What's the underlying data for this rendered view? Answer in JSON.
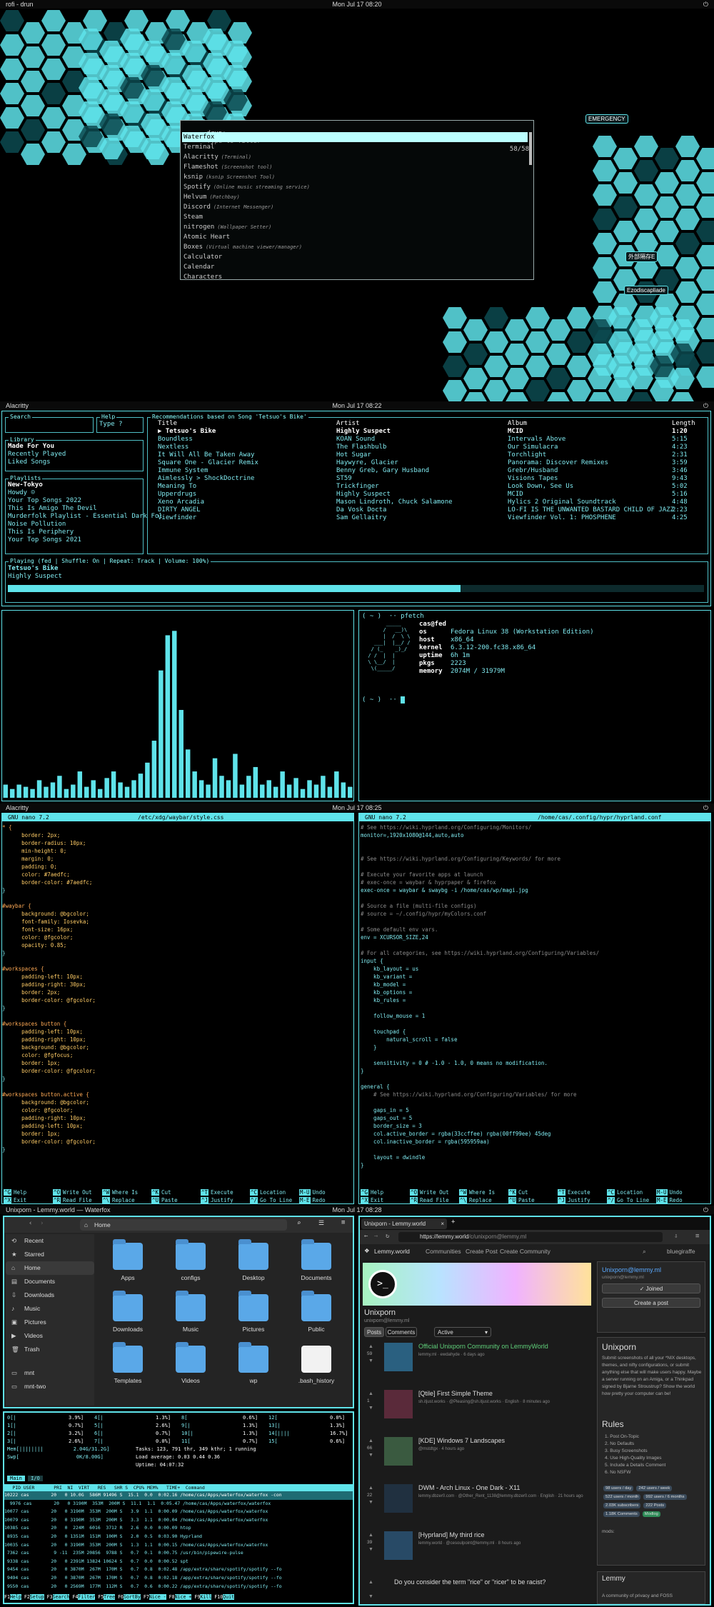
{
  "s1": {
    "left": "rofi - drun",
    "clock": "Mon Jul 17 08:20",
    "prompt": "drun:",
    "placeholder": "Type to filter",
    "count": "58/58",
    "items": [
      {
        "n": "Waterfox",
        "d": ""
      },
      {
        "n": "Terminal",
        "d": ""
      },
      {
        "n": "Alacritty",
        "d": "(Terminal)"
      },
      {
        "n": "Flameshot",
        "d": "(Screenshot tool)"
      },
      {
        "n": "ksnip",
        "d": "(ksnip Screenshot Tool)"
      },
      {
        "n": "Spotify",
        "d": "(Online music streaming service)"
      },
      {
        "n": "Helvum",
        "d": "(Patchbay)"
      },
      {
        "n": "Discord",
        "d": "(Internet Messenger)"
      },
      {
        "n": "Steam",
        "d": ""
      },
      {
        "n": "nitrogen",
        "d": "(Wallpaper Setter)"
      },
      {
        "n": "Atomic Heart",
        "d": ""
      },
      {
        "n": "Boxes",
        "d": "(Virtual machine viewer/manager)"
      },
      {
        "n": "Calculator",
        "d": ""
      },
      {
        "n": "Calendar",
        "d": ""
      },
      {
        "n": "Characters",
        "d": ""
      }
    ],
    "hexlabels": [
      "EMERGENCY",
      "外部隔存E",
      "Ezodiscapliade"
    ]
  },
  "s2": {
    "left": "Alacritty",
    "clock": "Mon Jul 17 08:22",
    "search": {
      "label": "Search"
    },
    "help": {
      "label": "Help",
      "value": "Type ?"
    },
    "library": {
      "label": "Library",
      "items": [
        "Made For You",
        "Recently Played",
        "Liked Songs"
      ]
    },
    "playlists": {
      "label": "Playlists",
      "items": [
        "New-Tokyo",
        "Howdy ☺",
        "Your Top Songs 2022",
        "This Is Amigo The Devil",
        "Murderfolk Playlist - Essential Dark Fol",
        "Noise Pollution",
        "This Is Periphery",
        "Your Top Songs 2021"
      ]
    },
    "recs": {
      "label": "Recommendations based on Song 'Tetsuo's Bike'",
      "headers": [
        "Title",
        "Artist",
        "Album",
        "Length"
      ],
      "rows": [
        [
          "▶ Tetsuo's Bike",
          "Highly Suspect",
          "MCID",
          "1:20"
        ],
        [
          "Boundless",
          "KOAN Sound",
          "Intervals Above",
          "5:15"
        ],
        [
          "Nextless",
          "The Flashbulb",
          "Our Simulacra",
          "4:23"
        ],
        [
          "It Will All Be Taken Away",
          "Hot Sugar",
          "Torchlight",
          "2:31"
        ],
        [
          "Square One - Glacier Remix",
          "Haywyre, Glacier",
          "Panorama: Discover Remixes",
          "3:59"
        ],
        [
          "Immune System",
          "Benny Greb, Gary Husband",
          "Grebr/Husband",
          "3:46"
        ],
        [
          "Aimlessly > ShockDoctrine",
          "ST59",
          "Visions Tapes",
          "9:43"
        ],
        [
          "Meaning To",
          "Trickfinger",
          "Look Down, See Us",
          "5:02"
        ],
        [
          "Upperdrugs",
          "Highly Suspect",
          "MCID",
          "5:16"
        ],
        [
          "Xeno Arcadia",
          "Mason Lindroth, Chuck Salamone",
          "Hylics 2 Original Soundtrack",
          "4:48"
        ],
        [
          "DIRTY ANGEL",
          "Da Vosk Docta",
          "LO-FI IS THE UNWANTED BASTARD CHILD OF JAZZ",
          "2:23"
        ],
        [
          "Viewfinder",
          "Sam Gellaitry",
          "Viewfinder Vol. 1: PHOSPHENE",
          "4:25"
        ]
      ]
    },
    "playing": {
      "status": "Playing (fed | Shuffle: On  | Repeat: Track | Volume: 100%)",
      "track": "Tetsuo's Bike",
      "artist": "Highly Suspect",
      "progress": 0.65
    },
    "viz": [
      6,
      4,
      6,
      5,
      4,
      8,
      5,
      7,
      10,
      4,
      6,
      12,
      5,
      8,
      4,
      9,
      12,
      7,
      5,
      8,
      11,
      16,
      26,
      58,
      74,
      76,
      40,
      22,
      12,
      8,
      6,
      18,
      10,
      8,
      20,
      6,
      10,
      14,
      6,
      8,
      5,
      12,
      6,
      9,
      4,
      8,
      6,
      10,
      5,
      12,
      7,
      5
    ],
    "pf": {
      "prompt": "( ~ )  ·· pfetch",
      "user": "cas@fed",
      "rows": [
        [
          "os",
          "Fedora Linux 38 (Workstation Edition)"
        ],
        [
          "host",
          "x86_64"
        ],
        [
          "kernel",
          "6.3.12-200.fc38.x86_64"
        ],
        [
          "uptime",
          "6h 1m"
        ],
        [
          "pkgs",
          "2223"
        ],
        [
          "memory",
          "2074M / 31979M"
        ]
      ],
      "prompt2": "( ~ )  ··"
    }
  },
  "s3": {
    "left": "Alacritty",
    "clock": "Mon Jul 17 08:25",
    "nano1": {
      "ver": "GNU nano 7.2",
      "file": "/etc/xdg/waybar/style.css"
    },
    "nano2": {
      "ver": "GNU nano 7.2",
      "file": "/home/cas/.config/hypr/hyprland.conf"
    },
    "keys": [
      [
        "^G",
        "Help"
      ],
      [
        "^O",
        "Write Out"
      ],
      [
        "^W",
        "Where Is"
      ],
      [
        "^K",
        "Cut"
      ],
      [
        "^T",
        "Execute"
      ],
      [
        "^C",
        "Location"
      ],
      [
        "M-U",
        "Undo"
      ],
      [
        "^X",
        "Exit"
      ],
      [
        "^R",
        "Read File"
      ],
      [
        "^\\",
        "Replace"
      ],
      [
        "^U",
        "Paste"
      ],
      [
        "^J",
        "Justify"
      ],
      [
        "^/",
        "Go To Line"
      ],
      [
        "M-E",
        "Redo"
      ]
    ],
    "css": [
      "* {",
      "      border: 2px;",
      "      border-radius: 10px;",
      "      min-height: 0;",
      "      margin: 0;",
      "      padding: 0;",
      "      color: #7aedfc;",
      "      border-color: #7aedfc;",
      "}",
      "",
      "#waybar {",
      "      background: @bgcolor;",
      "      font-family: Iosevka;",
      "      font-size: 16px;",
      "      color: @fgcolor;",
      "      opacity: 0.85;",
      "}",
      "",
      "#workspaces {",
      "      padding-left: 10px;",
      "      padding-right: 30px;",
      "      border: 2px;",
      "      border-color: @fgcolor;",
      "}",
      "",
      "#workspaces button {",
      "      padding-left: 10px;",
      "      padding-right: 10px;",
      "      background: @bgcolor;",
      "      color: @fgfocus;",
      "      border: 1px;",
      "      border-color: @fgcolor;",
      "}",
      "",
      "#workspaces button.active {",
      "      background: @bgcolor;",
      "      color: @fgcolor;",
      "      padding-right: 10px;",
      "      padding-left: 10px;",
      "      border: 1px;",
      "      border-color: @fgcolor;",
      "}"
    ],
    "conf": [
      "# See https://wiki.hyprland.org/Configuring/Monitors/",
      "monitor=,1920x1080@144,auto,auto",
      "",
      "",
      "# See https://wiki.hyprland.org/Configuring/Keywords/ for more",
      "",
      "# Execute your favorite apps at launch",
      "# exec-once = waybar & hyprpaper & firefox",
      "exec-once = waybar & swaybg -i /home/cas/wp/magi.jpg",
      "",
      "# Source a file (multi-file configs)",
      "# source = ~/.config/hypr/myColors.conf",
      "",
      "# Some default env vars.",
      "env = XCURSOR_SIZE,24",
      "",
      "# For all categories, see https://wiki.hyprland.org/Configuring/Variables/",
      "input {",
      "    kb_layout = us",
      "    kb_variant =",
      "    kb_model =",
      "    kb_options =",
      "    kb_rules =",
      "",
      "    follow_mouse = 1",
      "",
      "    touchpad {",
      "        natural_scroll = false",
      "    }",
      "",
      "    sensitivity = 0 # -1.0 - 1.0, 0 means no modification.",
      "}",
      "",
      "general {",
      "    # See https://wiki.hyprland.org/Configuring/Variables/ for more",
      "",
      "    gaps_in = 5",
      "    gaps_out = 5",
      "    border_size = 3",
      "    col.active_border = rgba(33ccffee) rgba(00ff99ee) 45deg",
      "    col.inactive_border = rgba(595959aa)",
      "",
      "    layout = dwindle",
      "}"
    ]
  },
  "s4": {
    "left": "Unixporn - Lemmy.world — Waterfox",
    "clock": "Mon Jul 17 08:28",
    "files": {
      "path": "Home",
      "side": [
        "Recent",
        "Starred",
        "Home",
        "Documents",
        "Downloads",
        "Music",
        "Pictures",
        "Videos",
        "Trash",
        "mnt",
        "mnt-two"
      ],
      "icons": [
        [
          "Apps",
          "configs",
          "Desktop",
          "Documents"
        ],
        [
          "Downloads",
          "Music",
          "Pictures",
          "Public"
        ],
        [
          "Templates",
          "Videos",
          "wp",
          ".bash_history"
        ]
      ]
    },
    "htop": {
      "cpu": [
        [
          "0[|",
          "3.9%]",
          "4[|",
          "1.3%]",
          "8[",
          "0.6%]",
          "12[",
          "0.0%]"
        ],
        [
          "1[|",
          "0.7%]",
          "5[|",
          "2.6%]",
          "9[|",
          "1.3%]",
          "13[|",
          "1.3%]"
        ],
        [
          "2[|",
          "3.2%]",
          "6[|",
          "0.7%]",
          "10[|",
          "1.3%]",
          "14[||||",
          "16.7%]"
        ],
        [
          "3[|",
          "2.6%]",
          "7[|",
          "0.0%]",
          "11[",
          "0.7%]",
          "15[",
          "0.6%]"
        ]
      ],
      "mem": "Mem[||||||||          2.04G/31.2G]",
      "swp": "Swp[                   0K/8.00G]",
      "tasks": "Tasks: 123, 791 thr, 349 kthr; 1 running",
      "load": "Load average: 0.03 0.44 0.36",
      "uptime": "Uptime: 04:07:32",
      "tabs": [
        "Main",
        "I/O"
      ],
      "header": "   PID USER       PRI  NI  VIRT   RES   SHR S  CPU% MEM%   TIME+  Command",
      "rows": [
        "10222 cas        20   0 10.0G  586M 91496 S  15.1  0.0  0:02.16 /home/cas/Apps/waterfox/waterfox -con",
        "  9976 cas        20   0 3190M  353M  200M S  11.1  1.1  0:05.47 /home/cas/Apps/waterfox/waterfox",
        "10077 cas        20   0 3190M  353M  200M S   3.9  1.1  0:00.09 /home/cas/Apps/waterfox/waterfox",
        "10079 cas        20   0 3190M  353M  200M S   3.3  1.1  0:00.04 /home/cas/Apps/waterfox/waterfox",
        "10385 cas        20   0  224M  6016  3712 R   2.6  0.0  0:00.09 htop",
        " 8935 cas        20   0 1351M  151M  100M S   2.0  0.5  0:03.90 Hyprland",
        "10035 cas        20   0 3190M  353M  200M S   1.3  1.1  0:00.15 /home/cas/Apps/waterfox/waterfox",
        " 7362 cas         9 -11  235M 20856  9788 S   0.7  0.1  0:00.75 /usr/bin/pipewire-pulse",
        " 9338 cas        20   0 2391M 13824 10624 S   0.7  0.0  0:00.52 spt",
        " 9454 cas        20   0 3870M  267M  170M S   0.7  0.8  0:02.48 /app/extra/share/spotify/spotify --fo",
        " 9494 cas        20   0 3870M  267M  170M S   0.7  0.8  0:02.18 /app/extra/share/spotify/spotify --fo",
        " 9550 cas        20   0 2569M  177M  112M S   0.7  0.6  0:00.22 /app/extra/share/spotify/spotify --fo"
      ],
      "fkeys": [
        [
          "F1",
          "Help"
        ],
        [
          "F2",
          "Setup"
        ],
        [
          "F3",
          "Search"
        ],
        [
          "F4",
          "Filter"
        ],
        [
          "F5",
          "Tree"
        ],
        [
          "F6",
          "SortBy"
        ],
        [
          "F7",
          "Nice -"
        ],
        [
          "F8",
          "Nice +"
        ],
        [
          "F9",
          "Kill"
        ],
        [
          "F10",
          "Quit"
        ]
      ]
    },
    "browser": {
      "tab": "Unixporn - Lemmy.world",
      "url_host": "https://lemmy.world",
      "url_path": "/c/unixporn@lemmy.ml",
      "site": "Lemmy.world",
      "nav": [
        "Communities",
        "Create Post",
        "Create Community"
      ],
      "user": "bluegiraffe",
      "community": "Unixporn",
      "community_sub": "unixporn@lemmy.ml",
      "posts_tab": "Posts",
      "comments_tab": "Comments",
      "sort": "Active",
      "posts": [
        {
          "title": "Official Unixporn Community on LemmyWorld",
          "meta": "lemmy.ml · ewdahyde · 6 days ago",
          "votes": "59"
        },
        {
          "title": "[Qtile] First Simple Theme",
          "meta": "sh.itjust.works · @Pleasing@sh.itjust.works · English · 8 minutes ago",
          "votes": "1"
        },
        {
          "title": "[KDE] Windows 7 Landscapes",
          "meta": "@mstdtgx · 4 hours ago",
          "votes": "66"
        },
        {
          "title": "DWM - Arch Linux - One Dark - X11",
          "meta": "lemmy.dbzer0.com · @Other_Rent_1138@lemmy.dbzer0.com · English · 21 hours ago",
          "votes": "22"
        },
        {
          "title": "[Hyprland] My third rice",
          "meta": "lemmy.world · @cesoulpoint@lemmy.ml · 8 hours ago",
          "votes": "39"
        },
        {
          "title": "Do you consider the term \"rice\" or \"ricer\" to be racist?",
          "meta": "",
          "votes": ""
        }
      ],
      "side_title": "Unixporn@lemmy.ml",
      "side_sub": "unixporn@lemmy.ml",
      "joined": "✓ Joined",
      "create": "Create a post",
      "about_title": "Unixporn",
      "about": "Submit screenshots of all your *NIX desktops, themes, and nifty configurations, or submit anything else that will make users happy. Maybe a server running on an Amiga, or a Thinkpad signed by Bjarne Stroustrup? Show the world how pretty your computer can be!",
      "rules_title": "Rules",
      "rules": [
        "1. Post On-Topic",
        "2. No Defaults",
        "3. Busy Screenshots",
        "4. Use High-Quality Images",
        "5. Include a Details Comment",
        "6. No NSFW"
      ],
      "stats": [
        "98 users / day",
        "242 users / week",
        "522 users / month",
        "992 users / 6 months",
        "2.03K subscribers",
        "222 Posts",
        "1.18K Comments",
        "Modlog"
      ],
      "mods": "mods:",
      "footer_title": "Lemmy",
      "footer_text": "A community of privacy and FOSS"
    }
  },
  "colors": {
    "accent": "#5fe3ea",
    "bg": "#000000",
    "orange": "#ff7a5a"
  }
}
